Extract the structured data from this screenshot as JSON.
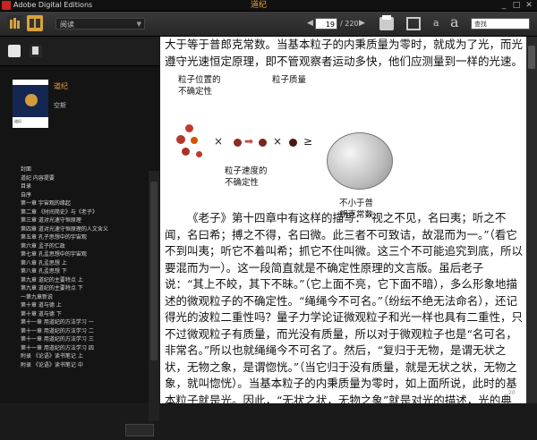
{
  "window": {
    "app_title": "Adobe Digital Editions",
    "doc_title": "道纪",
    "controls": [
      "_",
      "□",
      "✕"
    ]
  },
  "toolbar": {
    "view_mode": "阅读",
    "current_page": "19",
    "total_pages": "/ 220",
    "font_small": "a",
    "font_large": "a",
    "search_text": "查找"
  },
  "sidebar": {
    "book_title": "道纪",
    "book_author": "空斯",
    "cover_text": "道纪",
    "toc": [
      "封面",
      "道纪 内容提要",
      "目录",
      "自序",
      "第一章 宇宙观的缘起",
      "第二章 《时间简史》与《老子》",
      "第三章 道对光速守恒原理",
      "第四章 道对光速守恒原理的人文含义",
      "第五章 孔子思想中的宇宙观",
      "第六章 孟子的仁政",
      "第七章 孔孟思想中的宇宙观",
      "第八章 孔孟思想 上",
      "第八章 孔孟思想 下",
      "第九章 道纪的主要特点 上",
      "第九章 道纪的主要特点 下",
      "一第九章新说",
      "第十章 道与德 上",
      "第十章 道与德 下",
      "第十一章 用道纪的方法学习 一",
      "第十一章 用道纪的方法学习 二",
      "第十一章 用道纪的方法学习 三",
      "第十一章 用道纪的方法学习 四",
      "附录 《论语》读书笔记 上",
      "附录 《论语》读书笔记 中"
    ]
  },
  "content": {
    "para1": "大于等于普郎克常数。当基本粒子的内秉质量为零时，就成为了光，而光遵守光速恒定原理，即不管观察者运动多快，他们应测量到一样的光速。",
    "diagram": {
      "label_position": "粒子位置的\n不确定性",
      "label_mass": "粒子质量",
      "label_speed": "粒子速度的\n不确定性",
      "label_planck": "不小于普\n朗克常数",
      "times_1": "×",
      "times_2": "×",
      "arrow": "➡",
      "ge": "≥"
    },
    "para2": "《老子》第十四章中有这样的描写：“视之不见，名曰夷；听之不闻，名曰希；搏之不得，名曰微。此三者不可致诘，故混而为一。”（看它不到叫夷；听它不着叫希；抓它不住叫微。这三个不可能追究到底，所以要混而为一）。这一段简直就是不确定性原理的文言版。虽后老子说：“其上不皎，其下不昧。”（它上面不亮，它下面不暗），多么形象地描述的微观粒子的不确定性。“绳绳今不可名。”（纷纭不绝无法命名），还记得光的波粒二重性吗？量子力学论证微观粒子和光一样也具有二重性，只不过微观粒子有质量，而光没有质量，所以对于微观粒子也是“名可名，非常名。”所以也就绳绳今不可名了。然后，“复归于无物，是谓无状之状，无物之象，是谓惚恍。”（当它归于没有质量，就是无状之状，无物之象，就叫惚恍）。当基本粒子的内秉质量为零时，如上面所说，此时的基本粒子就是光。因此，“无状之状，无物之象”就是对光的描述，光的典型特征是波粒二重性，波是象、粒是状，光波没有质量，所以是无物之",
    "page_indicator": "20"
  },
  "colors": {
    "accent": "#e8a33a",
    "sidebar_bg": "#141414",
    "toolbar_bg": "#2e2e2e",
    "page_bg": "#ffffff"
  }
}
